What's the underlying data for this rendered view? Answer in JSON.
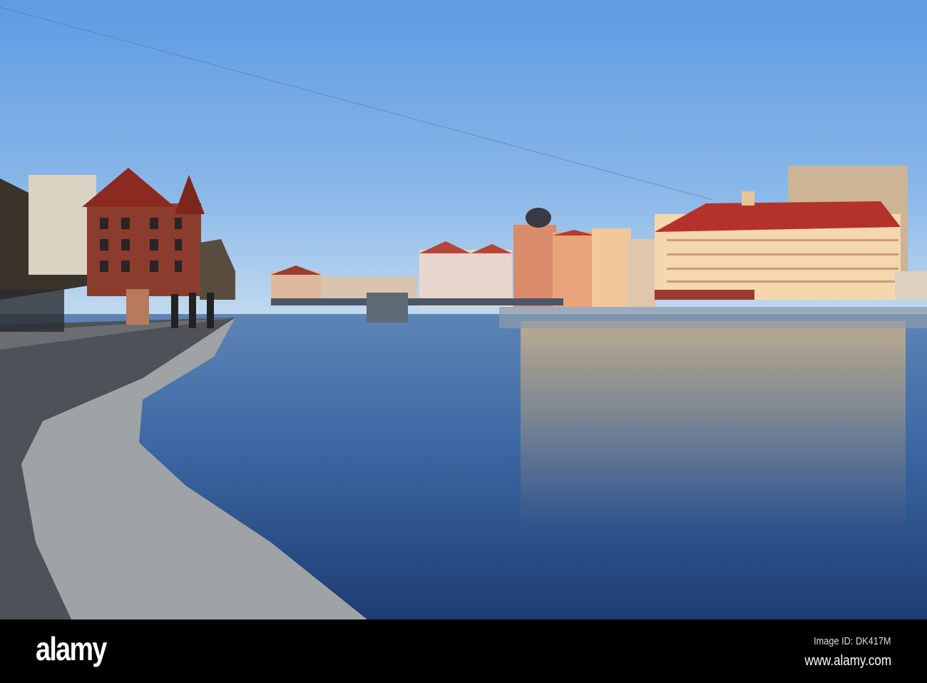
{
  "photo": {
    "subject": "River embankment with colorful buildings at sunset",
    "colors": {
      "sky_top": "#5e9be3",
      "sky_horizon": "#bcd7ee",
      "water_top": "#4a78b4",
      "water_bottom": "#1f3d73",
      "glow": "#e8b568"
    }
  },
  "footer": {
    "logo": "alamy",
    "image_id": "Image ID: DK417M",
    "site": "www.alamy.com"
  }
}
